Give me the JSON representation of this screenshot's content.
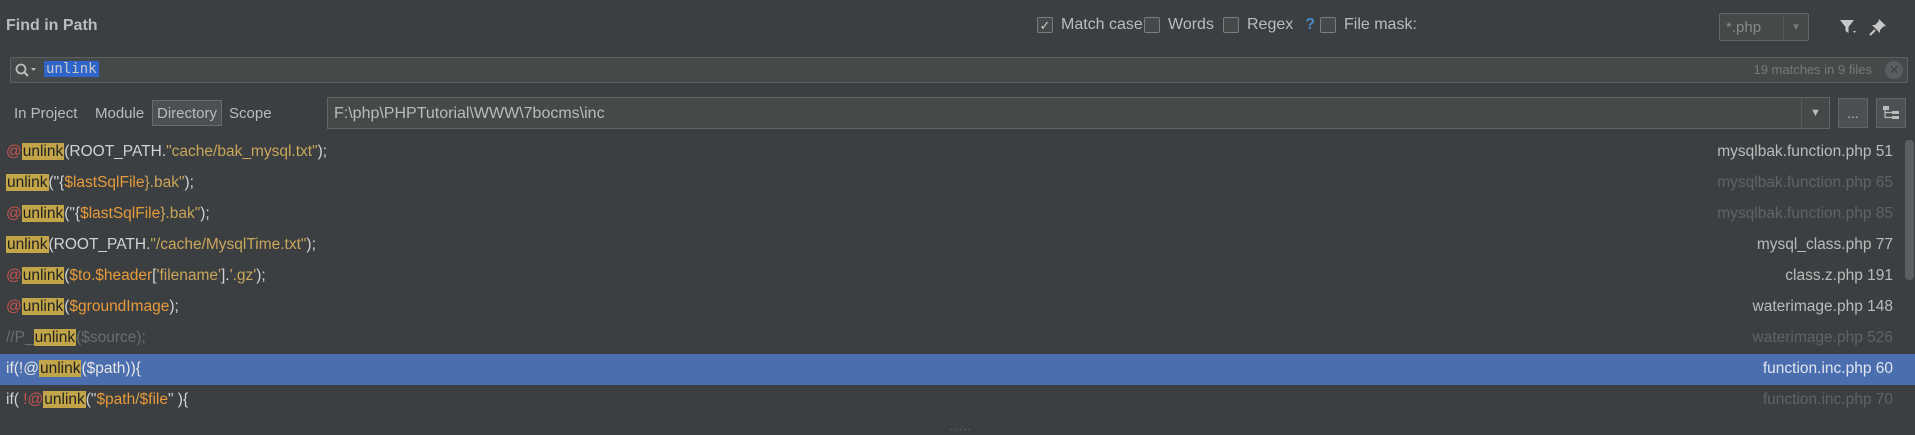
{
  "header": {
    "title": "Find in Path",
    "match_case": {
      "label": "Match case",
      "checked": true
    },
    "words": {
      "label": "Words",
      "checked": false
    },
    "regex": {
      "label": "Regex",
      "checked": false,
      "help": "?"
    },
    "file_mask": {
      "label": "File mask:",
      "checked": false,
      "value": "*.php"
    }
  },
  "search": {
    "query": "unlink",
    "count": "19 matches in 9 files"
  },
  "scope": {
    "tabs": [
      "In Project",
      "Module",
      "Directory",
      "Scope"
    ],
    "active": "Directory",
    "directory": "F:\\php\\PHPTutorial\\WWW\\7bocms\\inc",
    "browse_label": "..."
  },
  "results": [
    {
      "file": "mysqlbak.function.php 51",
      "dim": false
    },
    {
      "file": "mysqlbak.function.php 65",
      "dim": true
    },
    {
      "file": "mysqlbak.function.php 85",
      "dim": true
    },
    {
      "file": "mysql_class.php 77",
      "dim": false
    },
    {
      "file": "class.z.php 191",
      "dim": false
    },
    {
      "file": "waterimage.php 148",
      "dim": false
    },
    {
      "file": "waterimage.php 526",
      "dim": true
    },
    {
      "file": "function.inc.php 60",
      "dim": false,
      "selected": true
    },
    {
      "file": "function.inc.php 70",
      "dim": true
    }
  ],
  "code": {
    "r0": {
      "at": "@",
      "m": "unlink",
      "a": "(ROOT_PATH.",
      "s": "\"cache/bak_mysql.txt\"",
      "b": ");"
    },
    "r1": {
      "m": "unlink",
      "a": "(\"{",
      "v": "$lastSqlFile",
      "s": "}.bak\"",
      "b": ");"
    },
    "r2": {
      "at": "@",
      "m": "unlink",
      "a": "(\"{",
      "v": "$lastSqlFile",
      "s": "}.bak\"",
      "b": ");"
    },
    "r3": {
      "m": "unlink",
      "a": "(ROOT_PATH.",
      "s": "\"/cache/MysqlTime.txt\"",
      "b": ");"
    },
    "r4": {
      "at": "@",
      "m": "unlink",
      "a": "(",
      "v": "$to.$header",
      "c": "[",
      "s": "'filename'",
      "d": "].",
      "s2": "'.gz'",
      "b": ");"
    },
    "r5": {
      "at": "@",
      "m": "unlink",
      "a": "(",
      "v": "$groundImage",
      "b": ");"
    },
    "r6": {
      "c": "//P_",
      "m": "unlink",
      "d": "($source);"
    },
    "r7": {
      "a": "if(!@",
      "m": "unlink",
      "b": "($path)){"
    },
    "r8": {
      "a": "if( ",
      "at": "!@",
      "m": "unlink",
      "c": "(\"",
      "v": "$path",
      "s": "/",
      "v2": "$file",
      "d": "\" ){"
    }
  },
  "colors": {
    "background": "#3c3f41",
    "selection": "#4b6eaf",
    "match_highlight": "#c2a548",
    "search_selection": "#2f65ca"
  },
  "icons": [
    "search-icon",
    "clear-icon",
    "filter-icon",
    "pin-icon",
    "chevron-down-icon",
    "browse-icon",
    "tree-icon"
  ]
}
